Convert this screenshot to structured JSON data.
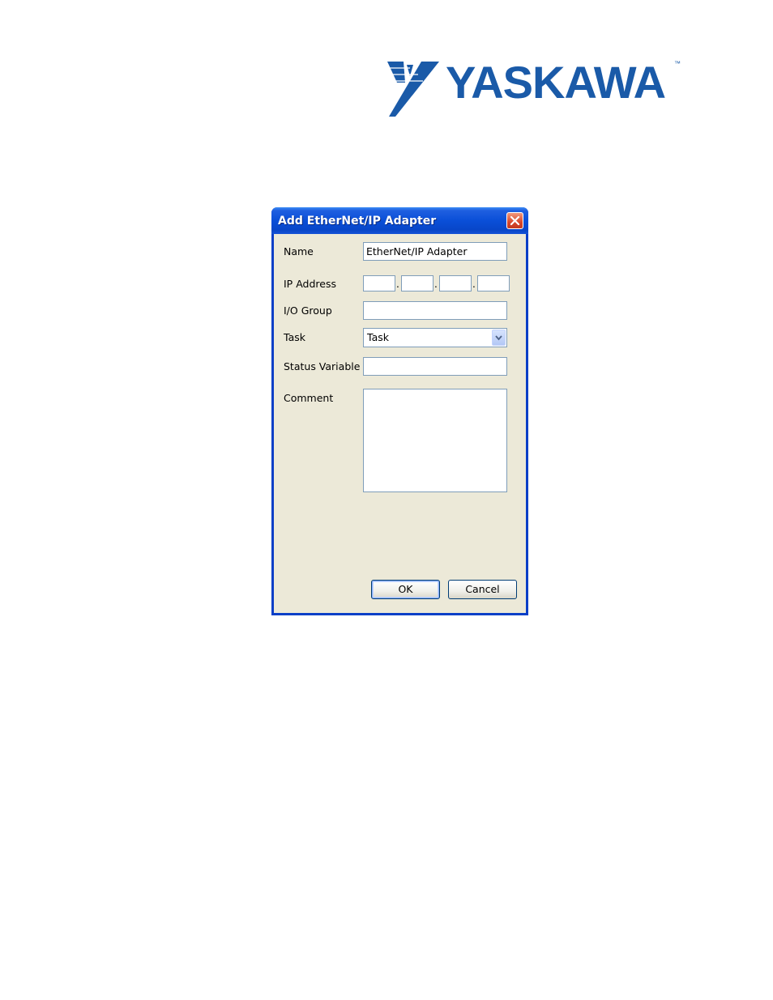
{
  "logo": {
    "text": "YASKAWA",
    "tm": "™"
  },
  "dialog": {
    "title": "Add EtherNet/IP Adapter",
    "fields": {
      "name_label": "Name",
      "name_value": "EtherNet/IP Adapter",
      "ip_label": "IP Address",
      "ip_octets": [
        "",
        "",
        "",
        ""
      ],
      "ip_separator": ".",
      "io_group_label": "I/O Group",
      "io_group_value": "",
      "task_label": "Task",
      "task_selected": "Task",
      "status_label": "Status Variable",
      "status_value": "",
      "comment_label": "Comment",
      "comment_value": ""
    },
    "buttons": {
      "ok": "OK",
      "cancel": "Cancel"
    }
  },
  "colors": {
    "brand_blue": "#1a5aa8",
    "titlebar_blue": "#0a4fd8",
    "dialog_bg": "#ece9d8",
    "close_red": "#d8472a",
    "field_border": "#7f9db9"
  },
  "icons": {
    "close": "close-icon",
    "dropdown": "chevron-down-icon",
    "logo_mark": "yaskawa-logo-icon"
  }
}
